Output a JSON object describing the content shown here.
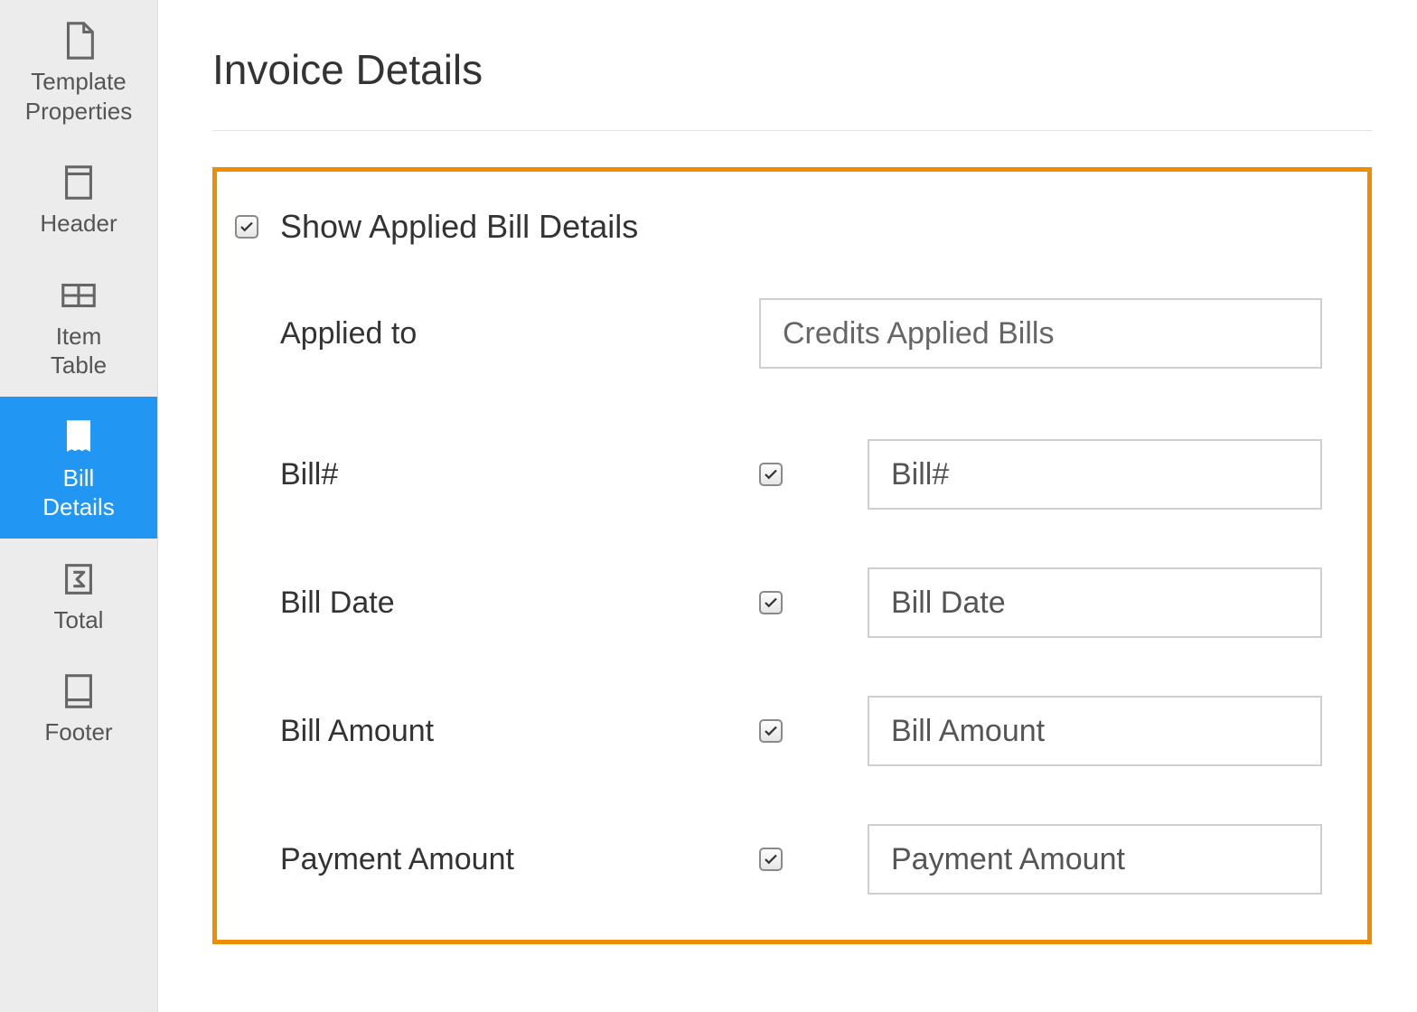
{
  "sidebar": {
    "items": [
      {
        "label": "Template\nProperties",
        "icon": "page-icon"
      },
      {
        "label": "Header",
        "icon": "header-icon"
      },
      {
        "label": "Item\nTable",
        "icon": "table-icon"
      },
      {
        "label": "Bill\nDetails",
        "icon": "receipt-icon",
        "active": true
      },
      {
        "label": "Total",
        "icon": "sigma-icon"
      },
      {
        "label": "Footer",
        "icon": "footer-icon"
      }
    ]
  },
  "main": {
    "title": "Invoice Details",
    "show_applied": {
      "checked": true,
      "label": "Show Applied Bill Details"
    },
    "applied_to": {
      "label": "Applied to",
      "value": "Credits Applied Bills"
    },
    "fields": [
      {
        "label": "Bill#",
        "checked": true,
        "value": "Bill#"
      },
      {
        "label": "Bill Date",
        "checked": true,
        "value": "Bill Date"
      },
      {
        "label": "Bill Amount",
        "checked": true,
        "value": "Bill Amount"
      },
      {
        "label": "Payment Amount",
        "checked": true,
        "value": "Payment Amount"
      }
    ]
  }
}
